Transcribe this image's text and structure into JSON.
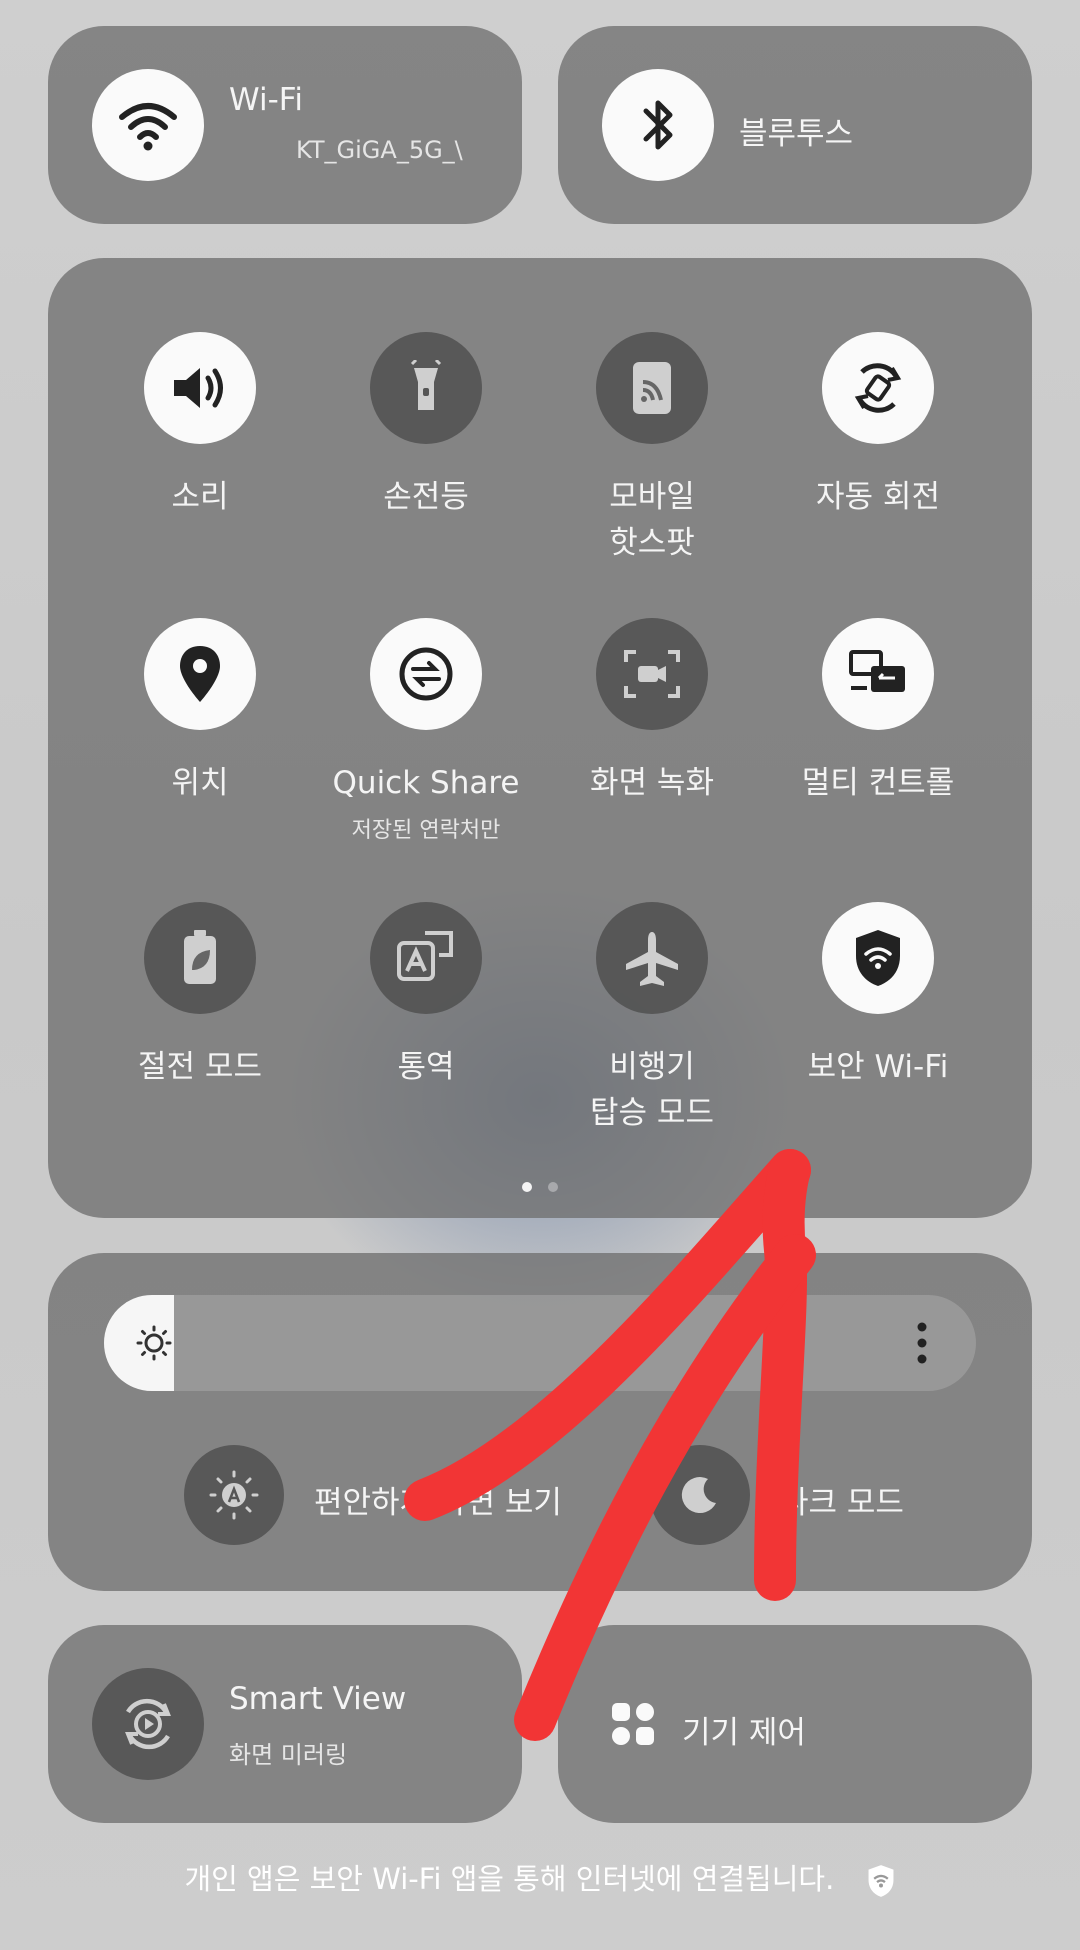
{
  "wifi": {
    "title": "Wi-Fi",
    "network": "KT_GiGA_5G_\\"
  },
  "bluetooth": {
    "title": "블루투스"
  },
  "tiles": [
    {
      "label": "소리",
      "sub": ""
    },
    {
      "label": "손전등",
      "sub": ""
    },
    {
      "label": "모바일\n핫스팟",
      "sub": ""
    },
    {
      "label": "자동 회전",
      "sub": ""
    },
    {
      "label": "위치",
      "sub": ""
    },
    {
      "label": "Quick Share",
      "sub": "저장된 연락처만"
    },
    {
      "label": "화면 녹화",
      "sub": ""
    },
    {
      "label": "멀티 컨트롤",
      "sub": ""
    },
    {
      "label": "절전 모드",
      "sub": ""
    },
    {
      "label": "통역",
      "sub": ""
    },
    {
      "label": "비행기\n탑승 모드",
      "sub": ""
    },
    {
      "label": "보안 Wi-Fi",
      "sub": ""
    }
  ],
  "brightness": {
    "level": 0.08
  },
  "eye_comfort": {
    "label": "편안하게 화면 보기"
  },
  "dark_mode": {
    "label": "다크 모드"
  },
  "smart_view": {
    "title": "Smart View",
    "sub": "화면 미러링"
  },
  "device_control": {
    "title": "기기 제어"
  },
  "footer": {
    "text": "개인 앱은 보안 Wi-Fi 앱을 통해 인터넷에 연결됩니다."
  },
  "colors": {
    "annotation": "#f23535",
    "tile_on": "#fafafa",
    "tile_off": "#505050"
  }
}
